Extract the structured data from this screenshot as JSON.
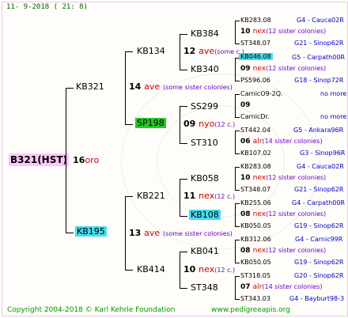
{
  "header": {
    "date": "11-   9-2018  (  21:   8)"
  },
  "colors": {
    "root_bg": "#fcc7fc",
    "green_bg": "#22cc22",
    "cyan_bg": "#44ddee",
    "race": "#cc0000",
    "note": "#6a00c8",
    "source": "#0000cc",
    "footer": "#009900"
  },
  "root": {
    "id": "B321(HST)",
    "num": "16",
    "race": "oro"
  },
  "g1": {
    "top": {
      "id": "KB321",
      "num": "14",
      "race": "ave",
      "note": "(some sister colonies)"
    },
    "bot": {
      "id": "KB195",
      "num": "13",
      "race": "ave",
      "note": "(some sister colonies)"
    }
  },
  "g2": {
    "a": {
      "id": "KB134",
      "num": "12",
      "race": "ave",
      "note": "(some c.)"
    },
    "b": {
      "id": "SP198",
      "num": "09",
      "race": "nyo",
      "note": "(12 c.)"
    },
    "c": {
      "id": "KB221",
      "num": "11",
      "race": "nex",
      "note": "(12 c.)"
    },
    "d": {
      "id": "KB414",
      "num": "10",
      "race": "nex",
      "note": "(12 c.)"
    }
  },
  "g3": [
    {
      "id": "KB384",
      "num": "",
      "race": "",
      "note": ""
    },
    {
      "id": "KB340",
      "num": "",
      "race": "",
      "note": ""
    },
    {
      "id": "SS299",
      "num": "",
      "race": "",
      "note": ""
    },
    {
      "id": "ST310",
      "num": "",
      "race": "",
      "note": ""
    },
    {
      "id": "KB058",
      "num": "",
      "race": "",
      "note": ""
    },
    {
      "id": "KB108",
      "num": "",
      "race": "",
      "note": ""
    },
    {
      "id": "KB041",
      "num": "",
      "race": "",
      "note": ""
    },
    {
      "id": "ST348",
      "num": "",
      "race": "",
      "note": ""
    }
  ],
  "g4": [
    {
      "top": "KB283.08",
      "topsrc": "G4 - Cauca02R",
      "num": "10",
      "race": "nex",
      "note": "(12 sister colonies)",
      "bot": "ST348.07",
      "botsrc": "G21 - Sinop62R"
    },
    {
      "top": "KB046.08",
      "topsrc": "G5 - Carpath00R",
      "num": "09",
      "race": "nex",
      "note": "(12 sister colonies)",
      "bot": "PS596.06",
      "botsrc": "G18 - Sinop72R"
    },
    {
      "top": "CarnicO9-2Q.",
      "topsrc": "no more",
      "num": "09",
      "race": "",
      "note": "",
      "bot": "CarnicDr.",
      "botsrc": "no more"
    },
    {
      "top": "ST442.04",
      "topsrc": "G5 - Ankara96R",
      "num": "06",
      "race": "alr",
      "note": "(14 sister colonies)",
      "bot": "KB107.02",
      "botsrc": "G3 - Sinop96R"
    },
    {
      "top": "KB283.08",
      "topsrc": "G4 - Cauca02R",
      "num": "10",
      "race": "nex",
      "note": "(12 sister colonies)",
      "bot": "ST348.07",
      "botsrc": "G21 - Sinop62R"
    },
    {
      "top": "KB255.06",
      "topsrc": "G4 - Carpath00R",
      "num": "08",
      "race": "nex",
      "note": "(12 sister colonies)",
      "bot": "KB050.05",
      "botsrc": "G19 - Sinop62R"
    },
    {
      "top": "KB312.06",
      "topsrc": "G4 - Carnic99R",
      "num": "08",
      "race": "nex",
      "note": "(12 sister colonies)",
      "bot": "KB050.05",
      "botsrc": "G19 - Sinop62R"
    },
    {
      "top": "ST318.05",
      "topsrc": "G20 - Sinop62R",
      "num": "07",
      "race": "alr",
      "note": "(14 sister colonies)",
      "bot": "ST343.03",
      "botsrc": "G4 - Bayburt98-3"
    }
  ],
  "footer": {
    "copyright": "Copyright 2004-2018 © Karl Kehrle Foundation",
    "site": "www.pedigreeapis.org"
  }
}
